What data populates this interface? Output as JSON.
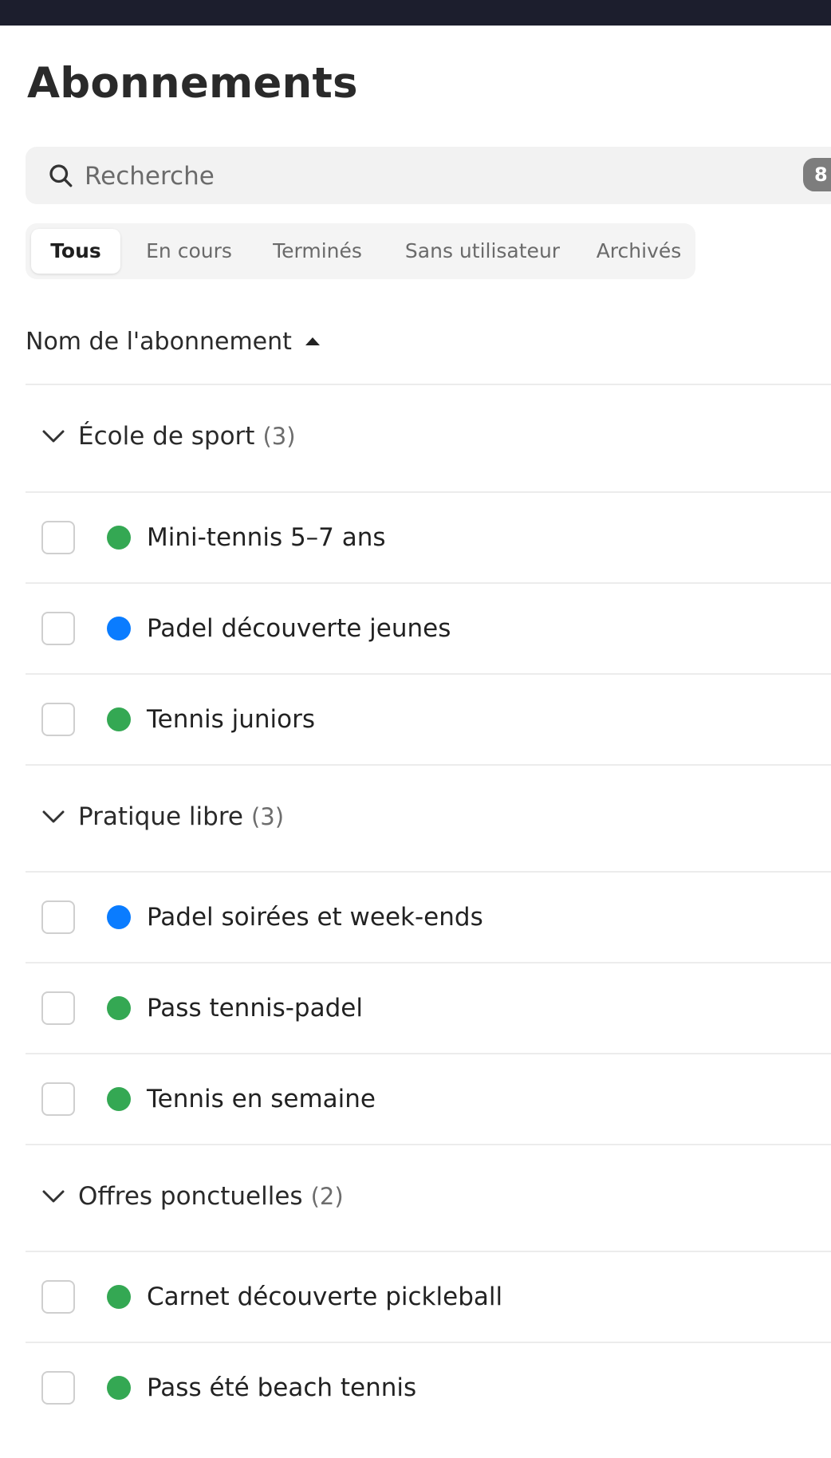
{
  "page": {
    "title": "Abonnements"
  },
  "search": {
    "placeholder": "Recherche",
    "count": "8"
  },
  "tabs": [
    {
      "label": "Tous",
      "active": true
    },
    {
      "label": "En cours",
      "active": false
    },
    {
      "label": "Terminés",
      "active": false
    },
    {
      "label": "Sans utilisateur",
      "active": false
    },
    {
      "label": "Archivés",
      "active": false
    }
  ],
  "table": {
    "sort_column": "Nom de l'abonnement",
    "sort_direction": "ascending"
  },
  "colors": {
    "green": "#34a853",
    "blue": "#0a7cff",
    "topbar": "#1c1e2d"
  },
  "icons": {
    "search": "search-icon",
    "sort": "caret-up-icon",
    "group": "chevron-down-icon"
  },
  "groups": [
    {
      "label": "École de sport",
      "count": "(3)",
      "items": [
        {
          "name": "Mini-tennis 5–7 ans",
          "status_color": "#34a853"
        },
        {
          "name": "Padel découverte jeunes",
          "status_color": "#0a7cff"
        },
        {
          "name": "Tennis juniors",
          "status_color": "#34a853"
        }
      ]
    },
    {
      "label": "Pratique libre",
      "count": "(3)",
      "items": [
        {
          "name": "Padel soirées et week-ends",
          "status_color": "#0a7cff"
        },
        {
          "name": "Pass tennis-padel",
          "status_color": "#34a853"
        },
        {
          "name": "Tennis en semaine",
          "status_color": "#34a853"
        }
      ]
    },
    {
      "label": "Offres ponctuelles",
      "count": "(2)",
      "items": [
        {
          "name": "Carnet découverte pickleball",
          "status_color": "#34a853"
        },
        {
          "name": "Pass été beach tennis",
          "status_color": "#34a853"
        }
      ]
    }
  ]
}
